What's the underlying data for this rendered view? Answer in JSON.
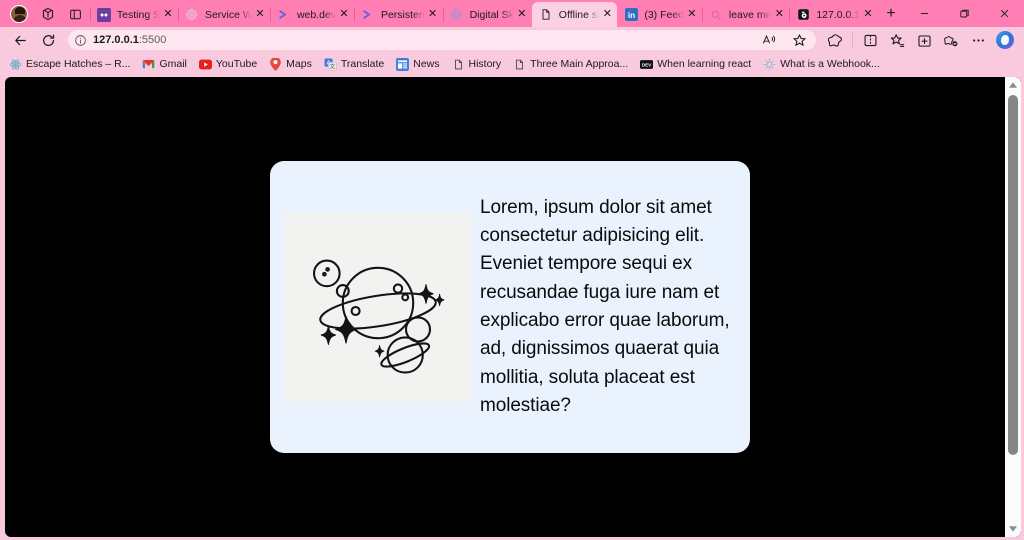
{
  "browser": {
    "profile": {
      "name": "profile-avatar"
    },
    "tabs": [
      {
        "title": "Testing S",
        "favicon": "media-icon",
        "active": false
      },
      {
        "title": "Service W",
        "favicon": "flower-icon",
        "active": false
      },
      {
        "title": "web.dev",
        "favicon": "webdev-icon",
        "active": false
      },
      {
        "title": "Persisten",
        "favicon": "webdev-icon",
        "active": false
      },
      {
        "title": "Digital Sk",
        "favicon": "globe-icon",
        "active": false
      },
      {
        "title": "Offline si",
        "favicon": "page-icon",
        "active": true
      },
      {
        "title": "(3) Feed",
        "favicon": "linkedin-icon",
        "active": false
      },
      {
        "title": "leave me",
        "favicon": "search-icon",
        "active": false
      },
      {
        "title": "127.0.0.1",
        "favicon": "lock-icon",
        "active": false
      }
    ],
    "new_tab_label": "+",
    "window_controls": {
      "minimize": "—",
      "maximize": "❐",
      "close": "✕"
    },
    "toolbar": {
      "back_label": "←",
      "refresh_label": "⟳",
      "url_host": "127.0.0.1",
      "url_port": ":5500",
      "url_full": "127.0.0.1:5500",
      "read_aloud_label": "A",
      "favorite_label": "☆",
      "icons": [
        "browser-essentials-icon",
        "split-screen-icon",
        "favorites-icon",
        "collections-icon",
        "drop-icon",
        "settings-more-icon",
        "copilot-icon"
      ]
    },
    "bookmarks": [
      {
        "label": "Escape Hatches – R...",
        "icon": "react-icon"
      },
      {
        "label": "Gmail",
        "icon": "gmail-icon"
      },
      {
        "label": "YouTube",
        "icon": "youtube-icon"
      },
      {
        "label": "Maps",
        "icon": "maps-icon"
      },
      {
        "label": "Translate",
        "icon": "translate-icon"
      },
      {
        "label": "News",
        "icon": "news-icon"
      },
      {
        "label": "History",
        "icon": "page-icon"
      },
      {
        "label": "Three Main Approa...",
        "icon": "page-icon"
      },
      {
        "label": "When learning react",
        "icon": "dev-icon"
      },
      {
        "label": "What is a Webhook...",
        "icon": "webhook-icon"
      }
    ]
  },
  "page": {
    "background_color": "#000000",
    "card": {
      "background_color": "#eaf2fd",
      "image_alt": "planet-illustration",
      "image_background_color": "#f2f2f0",
      "text": "Lorem, ipsum dolor sit amet consectetur adipisicing elit. Eveniet tempore sequi ex recusandae fuga iure nam et explicabo error quae laborum, ad, dignissimos quaerat quia mollitia, soluta placeat est molestiae?"
    },
    "scrollbar": {
      "up_arrow": "▲",
      "down_arrow": "▼"
    }
  }
}
